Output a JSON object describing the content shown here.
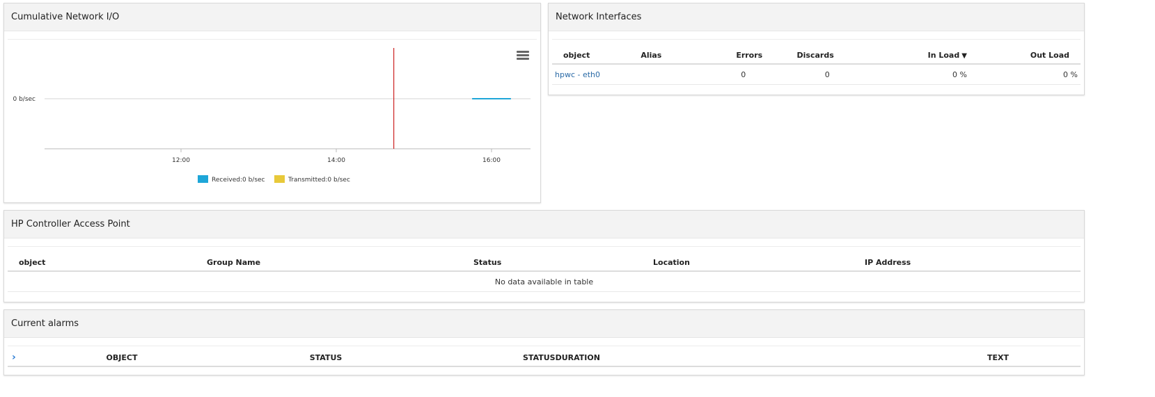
{
  "network_io": {
    "title": "Cumulative Network I/O",
    "menu_icon": "hamburger-menu-icon"
  },
  "chart_data": {
    "type": "line",
    "title": "",
    "xlabel": "",
    "ylabel": "",
    "x_ticks": [
      "12:00",
      "14:00",
      "16:00"
    ],
    "y_ticks": [
      "0 b/sec"
    ],
    "series": [
      {
        "name": "Received",
        "color": "#1ea6d8",
        "x": [
          "15:45",
          "16:15"
        ],
        "values": [
          0,
          0
        ]
      },
      {
        "name": "Transmitted",
        "color": "#e8c93a",
        "x": [],
        "values": []
      }
    ],
    "legend": [
      {
        "label": "Received:0 b/sec",
        "color": "#1ea6d8"
      },
      {
        "label": "Transmitted:0 b/sec",
        "color": "#e8c93a"
      }
    ],
    "legend_position": "bottom",
    "marker_line": {
      "x": "14:45",
      "color": "#cc2222"
    }
  },
  "interfaces": {
    "title": "Network Interfaces",
    "columns": [
      "object",
      "Alias",
      "Errors",
      "Discards",
      "In Load",
      "Out Load"
    ],
    "sort_indicator": "▼",
    "rows": [
      {
        "object": "hpwc - eth0",
        "alias": "",
        "errors": "0",
        "discards": "0",
        "in_load": "0 %",
        "out_load": "0 %"
      }
    ]
  },
  "access_point": {
    "title": "HP Controller Access Point",
    "columns": [
      "object",
      "Group Name",
      "Status",
      "Location",
      "IP Address"
    ],
    "empty_text": "No data available in table"
  },
  "alarms": {
    "title": "Current alarms",
    "expand_icon": "chevron-right-icon",
    "columns": [
      "OBJECT",
      "STATUS",
      "STATUSDURATION",
      "TEXT"
    ]
  }
}
